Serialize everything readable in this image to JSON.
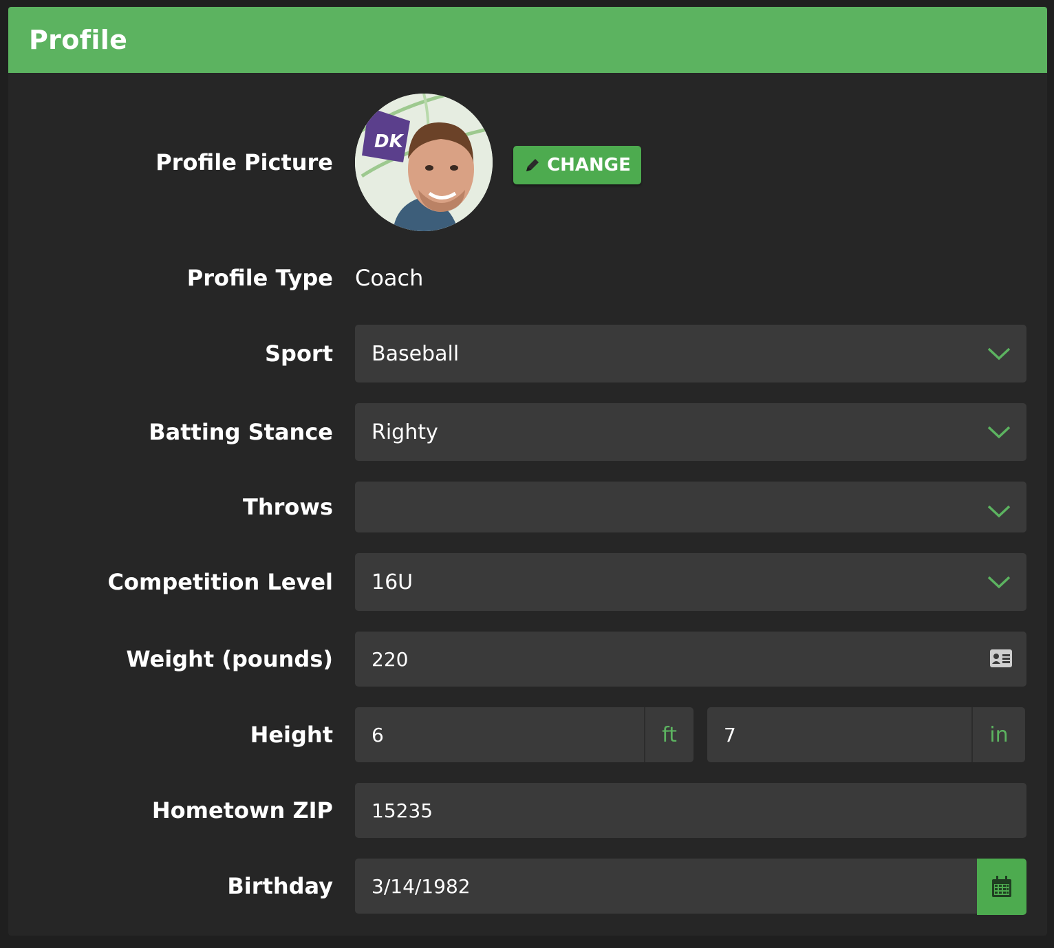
{
  "header": {
    "title": "Profile"
  },
  "profile_picture": {
    "label": "Profile Picture",
    "change_button": "CHANGE",
    "avatar_badge_text": "DK"
  },
  "profile_type": {
    "label": "Profile Type",
    "value": "Coach"
  },
  "sport": {
    "label": "Sport",
    "value": "Baseball"
  },
  "batting_stance": {
    "label": "Batting Stance",
    "value": "Righty"
  },
  "throws": {
    "label": "Throws",
    "value": ""
  },
  "competition_level": {
    "label": "Competition Level",
    "value": "16U"
  },
  "weight": {
    "label": "Weight (pounds)",
    "value": "220",
    "icon": "id-card-icon"
  },
  "height": {
    "label": "Height",
    "feet": "6",
    "feet_unit": "ft",
    "inches": "7",
    "inches_unit": "in"
  },
  "hometown_zip": {
    "label": "Hometown ZIP",
    "value": "15235"
  },
  "birthday": {
    "label": "Birthday",
    "value": "3/14/1982",
    "icon": "calendar-icon"
  },
  "colors": {
    "accent": "#5cb360",
    "panel_bg": "#262626",
    "field_bg": "#3a3a3a",
    "page_bg": "#1f1f1f"
  }
}
